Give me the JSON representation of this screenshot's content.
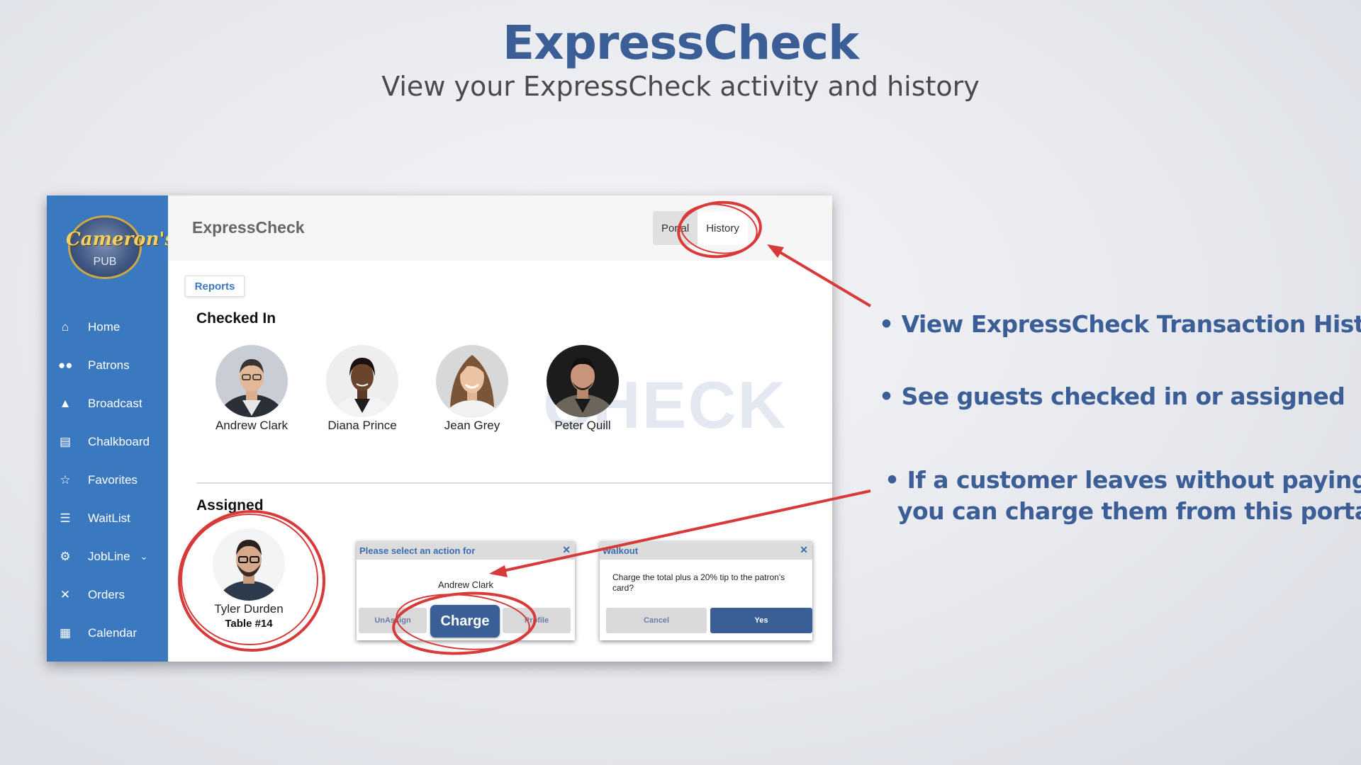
{
  "slide": {
    "title": "ExpressCheck",
    "subtitle": "View your ExpressCheck activity and history"
  },
  "sidebar": {
    "logo_main": "Cameron's",
    "logo_sub": "PUB",
    "items": [
      {
        "label": "Home",
        "icon": "home-icon"
      },
      {
        "label": "Patrons",
        "icon": "people-icon"
      },
      {
        "label": "Broadcast",
        "icon": "megaphone-icon"
      },
      {
        "label": "Chalkboard",
        "icon": "chalkboard-icon"
      },
      {
        "label": "Favorites",
        "icon": "star-icon"
      },
      {
        "label": "WaitList",
        "icon": "list-icon"
      },
      {
        "label": "JobLine",
        "icon": "person-search-icon"
      },
      {
        "label": "Orders",
        "icon": "utensils-icon"
      },
      {
        "label": "Calendar",
        "icon": "calendar-icon"
      }
    ]
  },
  "header": {
    "title": "ExpressCheck",
    "tabs": [
      {
        "label": "Portal",
        "active": false
      },
      {
        "label": "History",
        "active": true
      }
    ]
  },
  "main": {
    "reports_label": "Reports",
    "checked_in_label": "Checked In",
    "checked_in": [
      {
        "name": "Andrew Clark"
      },
      {
        "name": "Diana Prince"
      },
      {
        "name": "Jean Grey"
      },
      {
        "name": "Peter Quill"
      }
    ],
    "watermark": "CHECK",
    "assigned_label": "Assigned",
    "assigned": [
      {
        "name": "Tyler Durden",
        "table": "Table #14"
      }
    ]
  },
  "action_dialog": {
    "title": "Please select an action for",
    "patron": "Andrew Clark",
    "unassign_label": "UnAssign",
    "charge_label": "Charge",
    "profile_label": "Profile"
  },
  "walkout_dialog": {
    "title": "Walkout",
    "message": "Charge the total plus a 20% tip to the patron's card?",
    "cancel_label": "Cancel",
    "yes_label": "Yes"
  },
  "bullets": [
    "• View ExpressCheck Transaction History",
    "• See guests checked in or assigned",
    "• If a customer leaves without paying,",
    "you can charge them from this portal"
  ],
  "colors": {
    "brand_blue": "#3b5e97",
    "sidebar_blue": "#3a78c0",
    "annotation_red": "#d83a3a"
  }
}
